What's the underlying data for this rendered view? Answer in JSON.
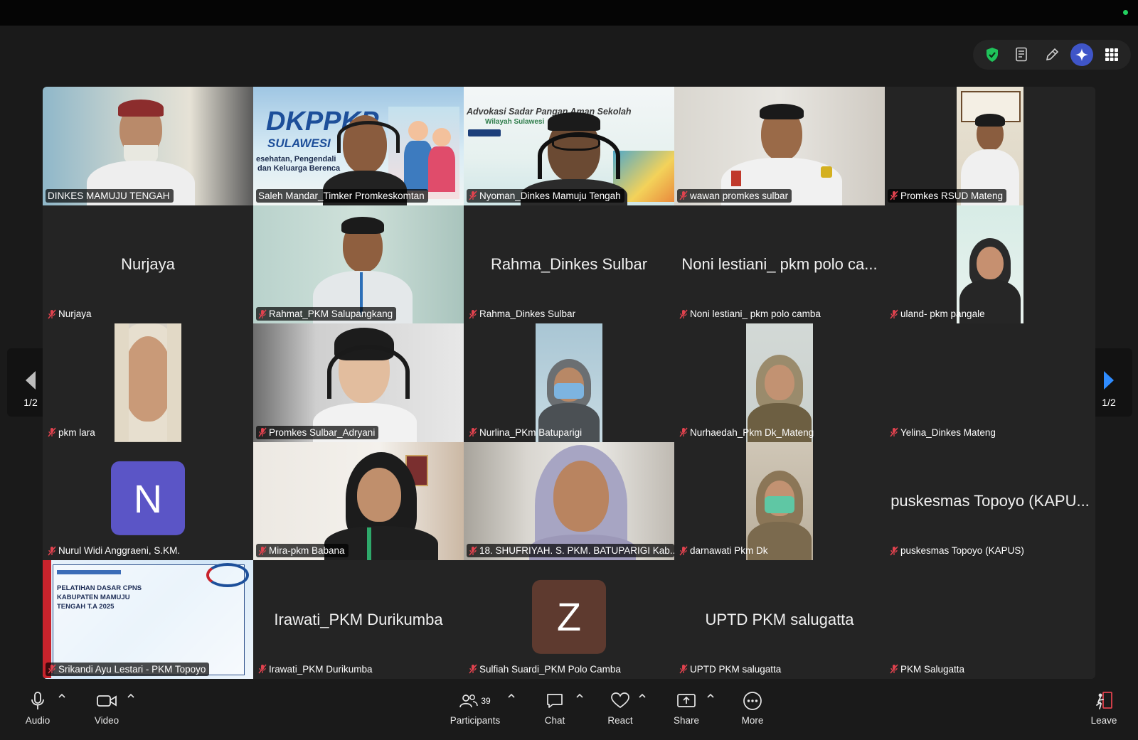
{
  "pager": {
    "left": "1/2",
    "right": "1/2"
  },
  "tiles": [
    {
      "name": "DINKES MAMUJU TENGAH",
      "label": "DINKES MAMUJU TENGAH",
      "muted": false
    },
    {
      "name": "Saleh Mandar",
      "label": "Saleh Mandar_Timker Promkeskomtan",
      "muted": false,
      "slide_title": "DKPPKP",
      "slide_sub": "SULAWESI",
      "slide_line1": "esehatan, Pengendali",
      "slide_line2": "dan Keluarga Berenca"
    },
    {
      "name": "Nyoman",
      "label": "Nyoman_Dinkes Mamuju Tengah",
      "muted": true,
      "slide_title": "Advokasi Sadar Pangan Aman Sekolah",
      "slide_sub": "Wilayah Sulawesi"
    },
    {
      "name": "wawan",
      "label": "wawan promkes sulbar",
      "muted": true
    },
    {
      "name": "Promkes RSUD",
      "label": "Promkes RSUD Mateng",
      "muted": true
    },
    {
      "name": "Nurjaya",
      "label": "Nurjaya",
      "muted": true,
      "center": "Nurjaya"
    },
    {
      "name": "Rahmat",
      "label": "Rahmat_PKM Salupangkang",
      "muted": true
    },
    {
      "name": "Rahma",
      "label": "Rahma_Dinkes Sulbar",
      "muted": true,
      "center": "Rahma_Dinkes Sulbar"
    },
    {
      "name": "Noni",
      "label": "Noni lestiani_ pkm polo camba",
      "muted": true,
      "center": "Noni lestiani_ pkm polo ca..."
    },
    {
      "name": "uland",
      "label": "uland- pkm pangale",
      "muted": true
    },
    {
      "name": "pkm lara",
      "label": "pkm lara",
      "muted": true
    },
    {
      "name": "Adryani",
      "label": "Promkes Sulbar_Adryani",
      "muted": true
    },
    {
      "name": "Nurlina",
      "label": "Nurlina_PKm Batuparigi",
      "muted": true
    },
    {
      "name": "Nurhaedah",
      "label": "Nurhaedah_Pkm Dk_Mateng",
      "muted": true
    },
    {
      "name": "Yelina",
      "label": "Yelina_Dinkes Mateng",
      "muted": true
    },
    {
      "name": "Nurul",
      "label": "Nurul Widi Anggraeni, S.KM.",
      "muted": true,
      "avatar": "N",
      "avatar_color": "#5b55c6"
    },
    {
      "name": "Mira",
      "label": "Mira-pkm Babana",
      "muted": true
    },
    {
      "name": "Shufriyah",
      "label": "18. SHUFRIYAH. S. PKM. BATUPARIGI Kab...",
      "muted": true
    },
    {
      "name": "darnawati",
      "label": "darnawati Pkm Dk",
      "muted": true
    },
    {
      "name": "Topoyo",
      "label": "puskesmas Topoyo (KAPUS)",
      "muted": true,
      "center": "puskesmas Topoyo (KAPU..."
    },
    {
      "name": "Srikandi",
      "label": "Srikandi Ayu Lestari - PKM Topoyo",
      "muted": true,
      "slide_line1": "PELATIHAN DASAR CPNS",
      "slide_line2": "KABUPATEN MAMUJU",
      "slide_line3": "TENGAH T.A 2025"
    },
    {
      "name": "Irawati",
      "label": "Irawati_PKM Durikumba",
      "muted": true,
      "center": "Irawati_PKM Durikumba"
    },
    {
      "name": "Sulfiah",
      "label": "Sulfiah Suardi_PKM Polo Camba",
      "muted": true,
      "avatar": "Z",
      "avatar_color": "#5e3a2f"
    },
    {
      "name": "UPTD",
      "label": "UPTD PKM salugatta",
      "muted": true,
      "center": "UPTD PKM salugatta"
    },
    {
      "name": "PKM Salugatta",
      "label": "PKM Salugatta",
      "muted": true
    }
  ],
  "toolbar": {
    "audio": "Audio",
    "video": "Video",
    "participants": "Participants",
    "participants_count": "39",
    "chat": "Chat",
    "react": "React",
    "share": "Share",
    "more": "More",
    "leave": "Leave"
  },
  "colors": {
    "active_speaker": "#19b54b",
    "muted_mic": "#e0424e",
    "leave": "#e0424e",
    "nav_arrow_active": "#2f8cff"
  }
}
